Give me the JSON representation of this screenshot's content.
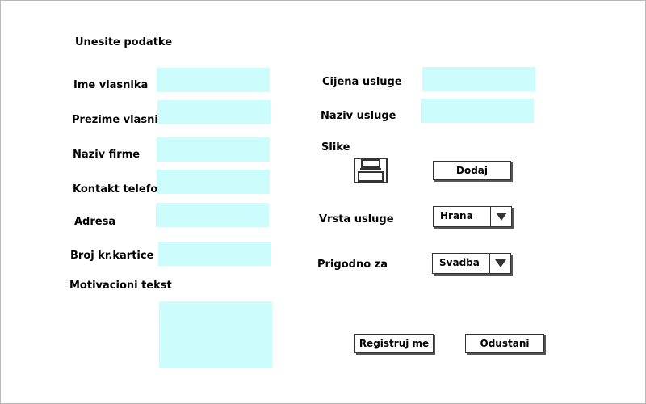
{
  "form": {
    "title": "Unesite podatke",
    "left_fields": [
      {
        "label": "Ime vlasnika",
        "value": ""
      },
      {
        "label": "Prezime vlasnika",
        "value": ""
      },
      {
        "label": "Naziv firme",
        "value": ""
      },
      {
        "label": "Kontakt telefon",
        "value": ""
      },
      {
        "label": "Adresa",
        "value": ""
      },
      {
        "label": "Broj kr.kartice",
        "value": ""
      }
    ],
    "motivation": {
      "label": "Motivacioni tekst",
      "value": ""
    },
    "service_price": {
      "label": "Cijena usluge",
      "value": ""
    },
    "service_name": {
      "label": "Naziv usluge",
      "value": ""
    },
    "images": {
      "label": "Slike",
      "icon": "save-icon",
      "add_button": "Dodaj"
    },
    "service_type": {
      "label": "Vrsta usluge",
      "selected": "Hrana"
    },
    "occasion": {
      "label": "Prigodno za",
      "selected": "Svadba"
    },
    "register_button": "Registruj me",
    "cancel_button": "Odustani"
  },
  "colors": {
    "field_background": "#ccfcfc",
    "border": "#333333"
  }
}
